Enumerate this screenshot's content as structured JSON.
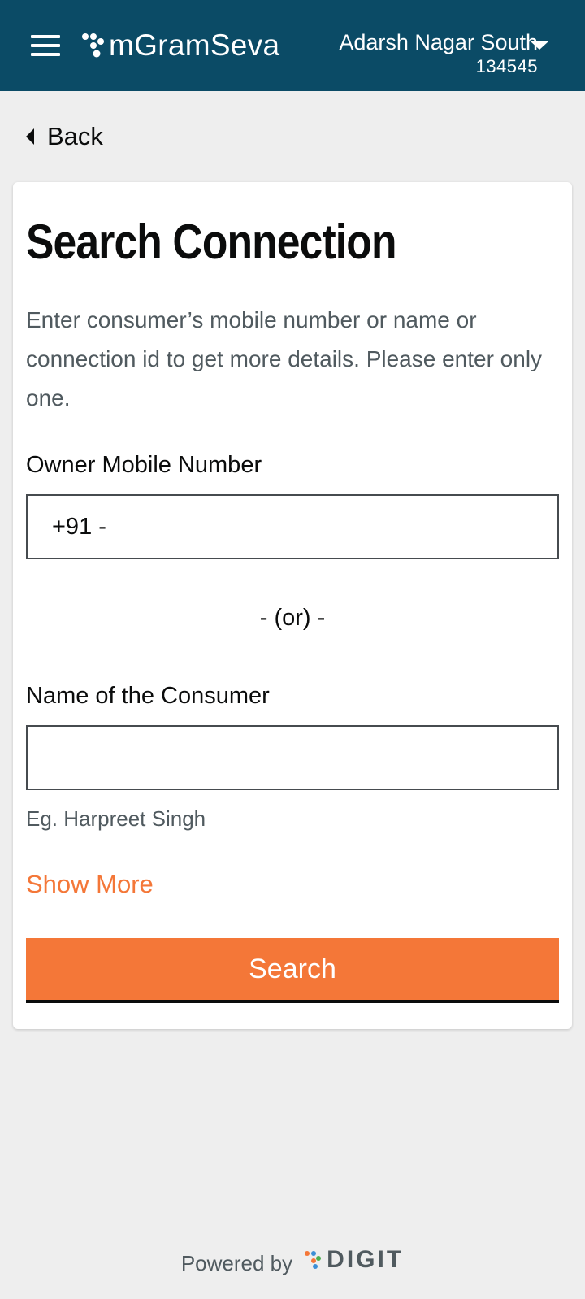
{
  "header": {
    "menu_icon": "hamburger-menu-icon",
    "app_name": "mGramSeva",
    "tenant_name": "Adarsh Nagar South",
    "tenant_code": "134545",
    "dropdown_icon": "caret-down-icon",
    "background_color": "#0b4b66"
  },
  "back": {
    "label": "Back",
    "icon": "caret-left-icon"
  },
  "form": {
    "title": "Search Connection",
    "description": "Enter consumer’s mobile number or name or connection id to get more details. Please enter only one.",
    "mobile_label": "Owner Mobile Number",
    "mobile_prefix": "+91 -",
    "mobile_value": "",
    "or_text": "- (or) -",
    "name_label": "Name of the Consumer",
    "name_value": "",
    "name_hint": "Eg. Harpreet Singh",
    "show_more_label": "Show More",
    "search_button_label": "Search"
  },
  "footer": {
    "powered_by": "Powered by",
    "brand": "DIGIT"
  },
  "colors": {
    "accent": "#f47738",
    "primary": "#0b4b66",
    "page_background": "#eeeeee"
  }
}
